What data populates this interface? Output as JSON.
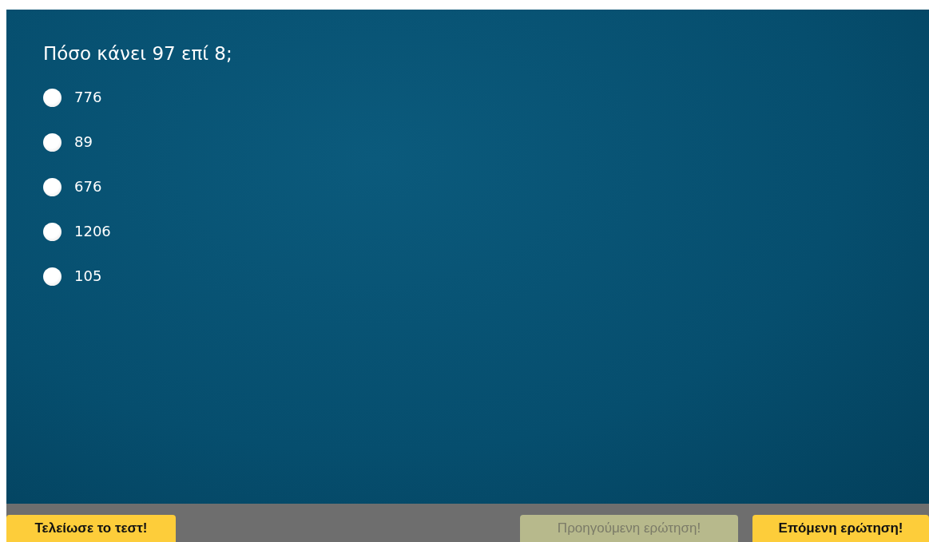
{
  "question": {
    "text": "Πόσο κάνει 97 επί 8;",
    "options": [
      {
        "label": "776",
        "selected": false
      },
      {
        "label": "89",
        "selected": false
      },
      {
        "label": "676",
        "selected": false
      },
      {
        "label": "1206",
        "selected": false
      },
      {
        "label": "105",
        "selected": false
      }
    ]
  },
  "footer": {
    "finish_button": {
      "label": "Τελείωσε το τεστ!",
      "disabled": false
    },
    "nav_buttons": [
      {
        "label": "Προηγούμενη ερώτηση!",
        "disabled": true
      },
      {
        "label": "Επόμενη ερώτηση!",
        "disabled": false
      }
    ]
  }
}
